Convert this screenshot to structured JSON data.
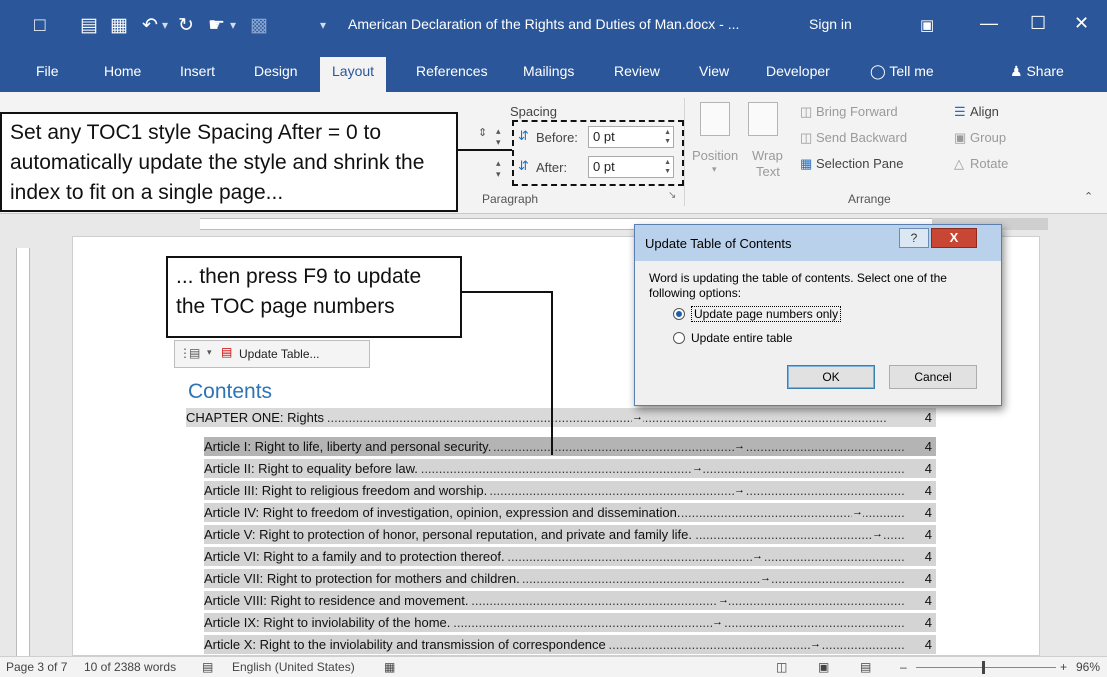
{
  "window": {
    "title": "American Declaration of the Rights and Duties of Man.docx - ...",
    "sign_in": "Sign in"
  },
  "tabs": [
    "File",
    "Home",
    "Insert",
    "Design",
    "Layout",
    "References",
    "Mailings",
    "Review",
    "View",
    "Developer"
  ],
  "tell_me": "Tell me",
  "share": "Share",
  "ribbon": {
    "spacing_label": "Spacing",
    "before_label": "Before:",
    "before_value": "0 pt",
    "after_label": "After:",
    "after_value": "0 pt",
    "paragraph_group": "Paragraph",
    "position_label": "Position",
    "wrap_label": "Wrap",
    "wrap_label2": "Text",
    "bring_forward": "Bring Forward",
    "send_backward": "Send Backward",
    "selection_pane": "Selection Pane",
    "align": "Align",
    "group": "Group",
    "rotate": "Rotate",
    "arrange_group": "Arrange"
  },
  "callouts": {
    "top": "Set any TOC1 style Spacing After = 0 to automatically update the style and shrink the index to fit on a single page...",
    "mid": "... then press F9  to update the TOC page numbers"
  },
  "toc": {
    "update_button": "Update Table...",
    "heading": "Contents",
    "entries": [
      {
        "text": "CHAPTER ONE: Rights",
        "page": "4"
      },
      {
        "text": "Article I: Right to life, liberty and personal security.",
        "page": "4"
      },
      {
        "text": "Article II: Right to equality before law.",
        "page": "4"
      },
      {
        "text": "Article III: Right to religious freedom and worship.",
        "page": "4"
      },
      {
        "text": "Article IV: Right to freedom of investigation, opinion, expression and dissemination.",
        "page": "4"
      },
      {
        "text": "Article V: Right to protection of honor, personal reputation, and private and family life.",
        "page": "4"
      },
      {
        "text": "Article VI: Right to a family and to protection thereof.",
        "page": "4"
      },
      {
        "text": "Article VII: Right to protection for mothers and children.",
        "page": "4"
      },
      {
        "text": "Article VIII: Right to residence and movement.",
        "page": "4"
      },
      {
        "text": "Article IX: Right to inviolability of the home.",
        "page": "4"
      },
      {
        "text": "Article X: Right to the inviolability and transmission of correspondence",
        "page": "4"
      }
    ]
  },
  "dialog": {
    "title": "Update Table of Contents",
    "message": "Word is updating the table of contents.  Select one of the following options:",
    "option1": "Update page numbers only",
    "option2": "Update entire table",
    "ok": "OK",
    "cancel": "Cancel",
    "help": "?",
    "close": "X"
  },
  "status": {
    "page": "Page 3 of 7",
    "words": "10 of 2388 words",
    "language": "English (United States)",
    "zoom": "96%"
  },
  "colors": {
    "brand": "#2b579a",
    "toc_heading": "#2e74b5",
    "selection": "#b4b4b4"
  }
}
